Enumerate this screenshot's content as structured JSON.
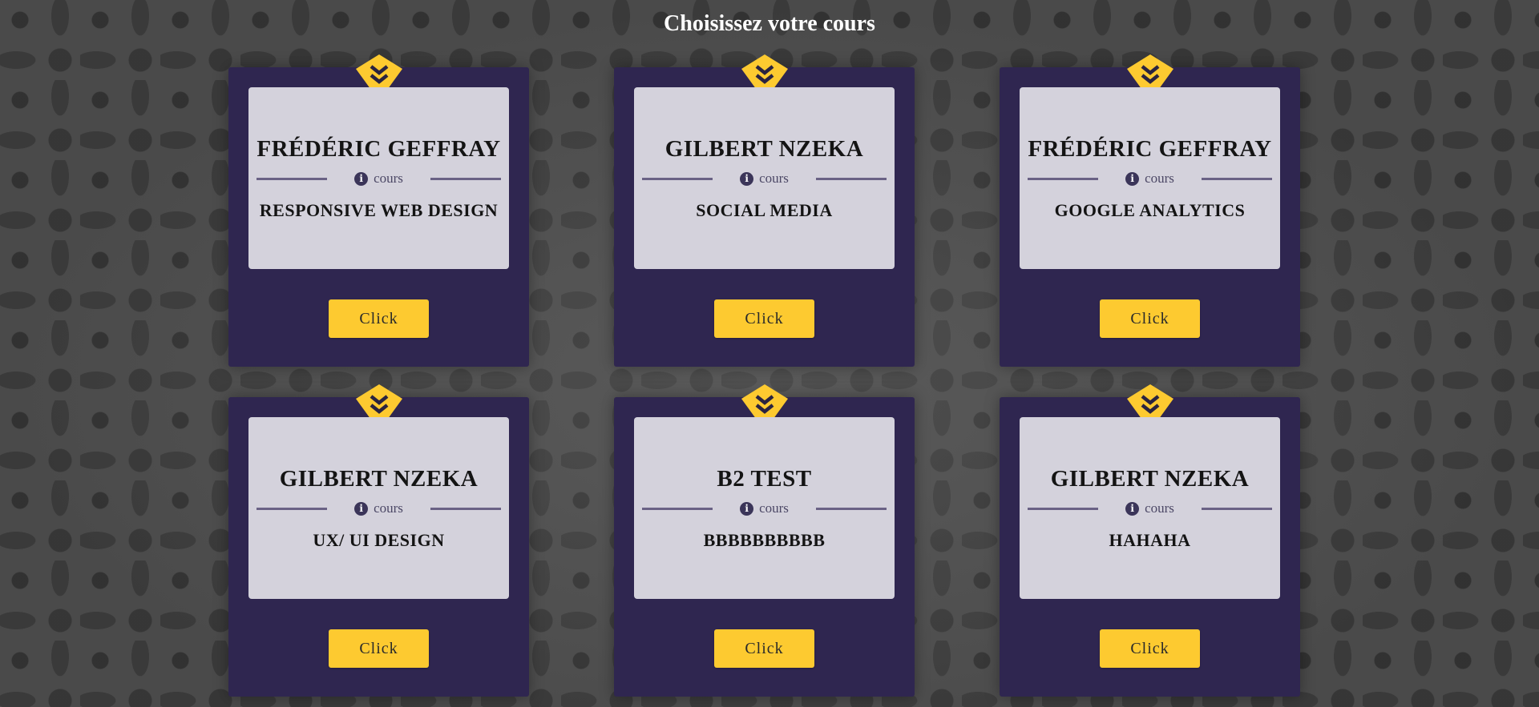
{
  "page": {
    "title": "Choisissez votre cours"
  },
  "colors": {
    "card_background": "#2f2650",
    "inner_panel": "#d4d2dc",
    "accent_yellow": "#fdca30",
    "divider": "#6a6285"
  },
  "icons": {
    "badge": "chevron-double-down-icon",
    "info": "info-circle-icon"
  },
  "courses": [
    {
      "teacher": "FRÉDÉRIC GEFFRAY",
      "label": "cours",
      "course": "RESPONSIVE WEB DESIGN",
      "button": "Click"
    },
    {
      "teacher": "GILBERT NZEKA",
      "label": "cours",
      "course": "SOCIAL MEDIA",
      "button": "Click"
    },
    {
      "teacher": "FRÉDÉRIC GEFFRAY",
      "label": "cours",
      "course": "GOOGLE ANALYTICS",
      "button": "Click"
    },
    {
      "teacher": "GILBERT NZEKA",
      "label": "cours",
      "course": "UX/ UI DESIGN",
      "button": "Click"
    },
    {
      "teacher": "B2 TEST",
      "label": "cours",
      "course": "BBBBBBBBBB",
      "button": "Click"
    },
    {
      "teacher": "GILBERT NZEKA",
      "label": "cours",
      "course": "HAHAHA",
      "button": "Click"
    }
  ]
}
